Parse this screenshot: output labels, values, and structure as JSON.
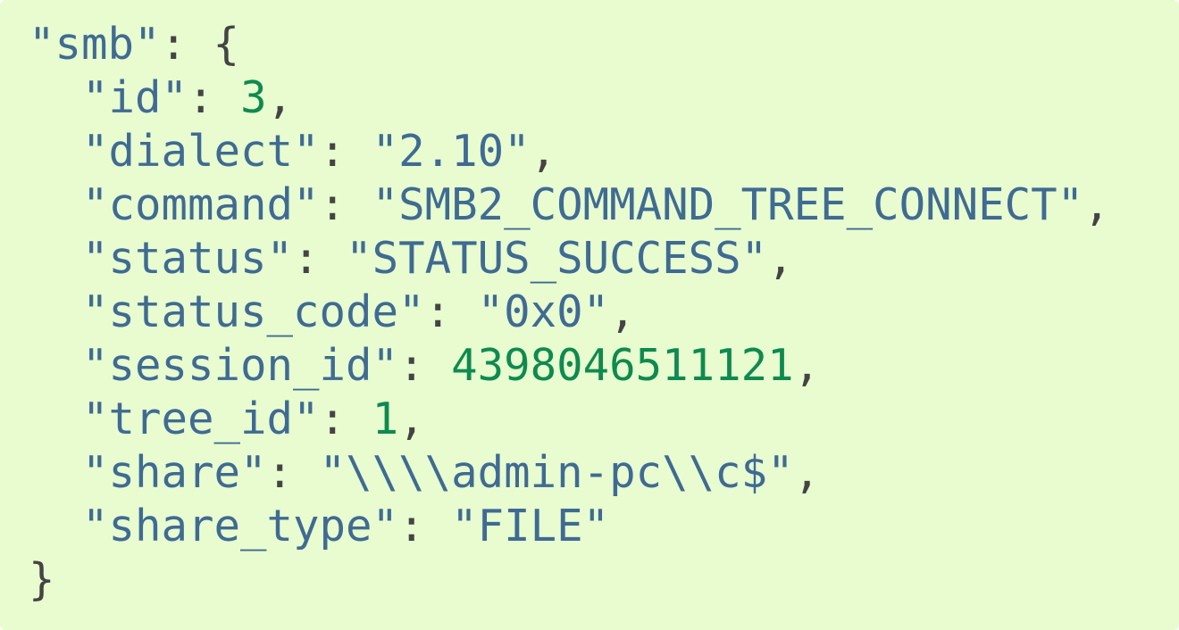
{
  "code": {
    "root_key": "smb",
    "fields": [
      {
        "key": "id",
        "value": "3",
        "type": "number"
      },
      {
        "key": "dialect",
        "value": "2.10",
        "type": "string"
      },
      {
        "key": "command",
        "value": "SMB2_COMMAND_TREE_CONNECT",
        "type": "string"
      },
      {
        "key": "status",
        "value": "STATUS_SUCCESS",
        "type": "string"
      },
      {
        "key": "status_code",
        "value": "0x0",
        "type": "string"
      },
      {
        "key": "session_id",
        "value": "4398046511121",
        "type": "number"
      },
      {
        "key": "tree_id",
        "value": "1",
        "type": "number"
      },
      {
        "key": "share",
        "value": "\\\\\\\\admin-pc\\\\c$",
        "type": "string"
      },
      {
        "key": "share_type",
        "value": "FILE",
        "type": "string"
      }
    ]
  },
  "colors": {
    "background": "#e8fcd0",
    "key": "#3f6b93",
    "string": "#3f6b93",
    "number": "#0f8a4f",
    "punctuation": "#444444"
  }
}
